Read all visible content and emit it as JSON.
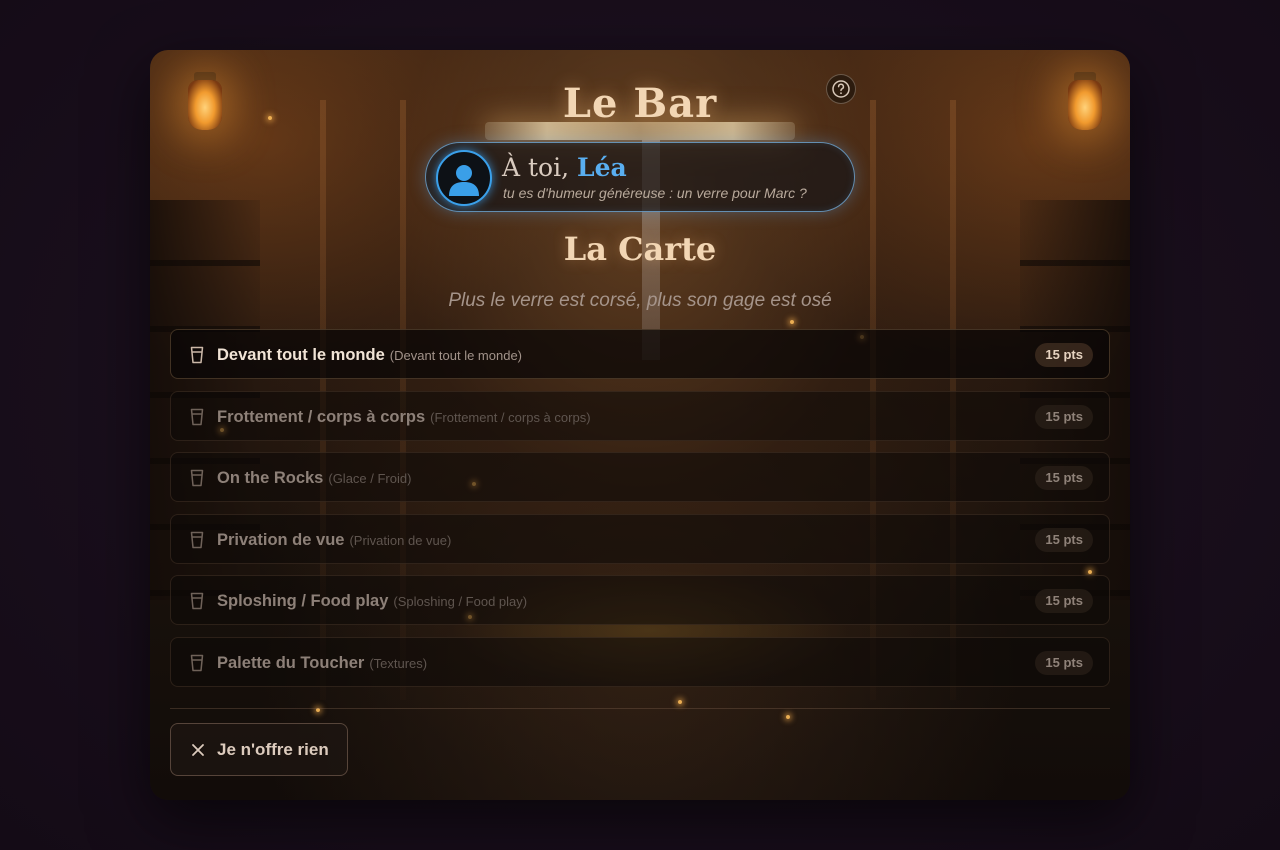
{
  "header": {
    "title": "Le Bar",
    "help_icon": "question-circle-icon"
  },
  "turn": {
    "prefix": "À toi, ",
    "player_name": "Léa",
    "message": "tu es d'humeur généreuse : un verre pour Marc ?",
    "avatar_icon": "user-silhouette-icon",
    "accent_color": "#3aa0ea"
  },
  "menu": {
    "title": "La Carte",
    "subtitle": "Plus le verre est corsé, plus son gage est osé",
    "item_icon": "glass-icon",
    "items": [
      {
        "label": "Devant tout le monde",
        "sub": "(Devant tout le monde)",
        "points": "15 pts",
        "active": true
      },
      {
        "label": "Frottement / corps à corps",
        "sub": "(Frottement / corps à corps)",
        "points": "15 pts",
        "active": false
      },
      {
        "label": "On the Rocks",
        "sub": "(Glace / Froid)",
        "points": "15 pts",
        "active": false
      },
      {
        "label": "Privation de vue",
        "sub": "(Privation de vue)",
        "points": "15 pts",
        "active": false
      },
      {
        "label": "Sploshing / Food play",
        "sub": "(Sploshing / Food play)",
        "points": "15 pts",
        "active": false
      },
      {
        "label": "Palette du Toucher",
        "sub": "(Textures)",
        "points": "15 pts",
        "active": false
      }
    ]
  },
  "footer": {
    "decline_label": "Je n'offre rien",
    "decline_icon": "close-icon"
  }
}
